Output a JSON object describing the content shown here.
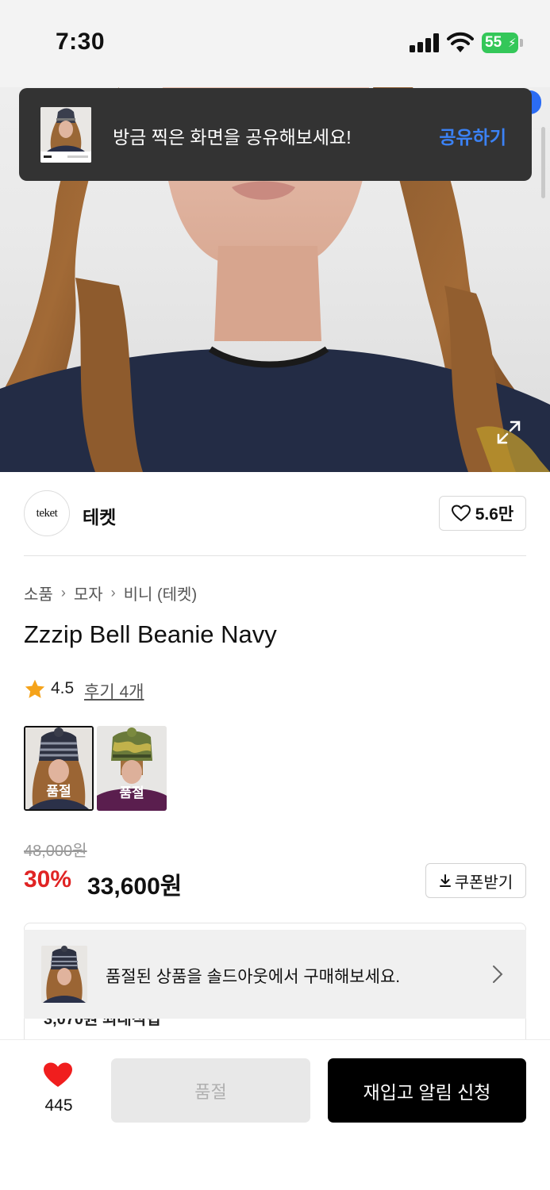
{
  "status_bar": {
    "time": "7:30",
    "battery": "55"
  },
  "toast": {
    "message": "방금 찍은 화면을 공유해보세요!",
    "action": "공유하기"
  },
  "brand": {
    "logo_text": "teket",
    "name": "테켓",
    "likes": "5.6만"
  },
  "breadcrumb": [
    "소품",
    "모자",
    "비니 (테켓)"
  ],
  "product": {
    "title": "Zzzip Bell Beanie Navy",
    "rating": "4.5",
    "reviews": "후기 4개",
    "original_price": "48,000원",
    "discount": "30%",
    "sale_price": "33,600원"
  },
  "color_options": [
    {
      "label": "품절",
      "selected": true
    },
    {
      "label": "품절",
      "selected": false
    }
  ],
  "coupon": {
    "label": "쿠폰받기"
  },
  "benefit": {
    "peek_text": "3,070원 최대적립"
  },
  "soldout_banner": {
    "text": "품절된 상품을 솔드아웃에서 구매해보세요."
  },
  "bottom_bar": {
    "wish_count": "445",
    "soldout_label": "품절",
    "restock_label": "재입고 알림 신청"
  },
  "colors": {
    "accent_blue": "#3b82f6",
    "discount_red": "#e02424",
    "heart_red": "#f01e1e"
  }
}
